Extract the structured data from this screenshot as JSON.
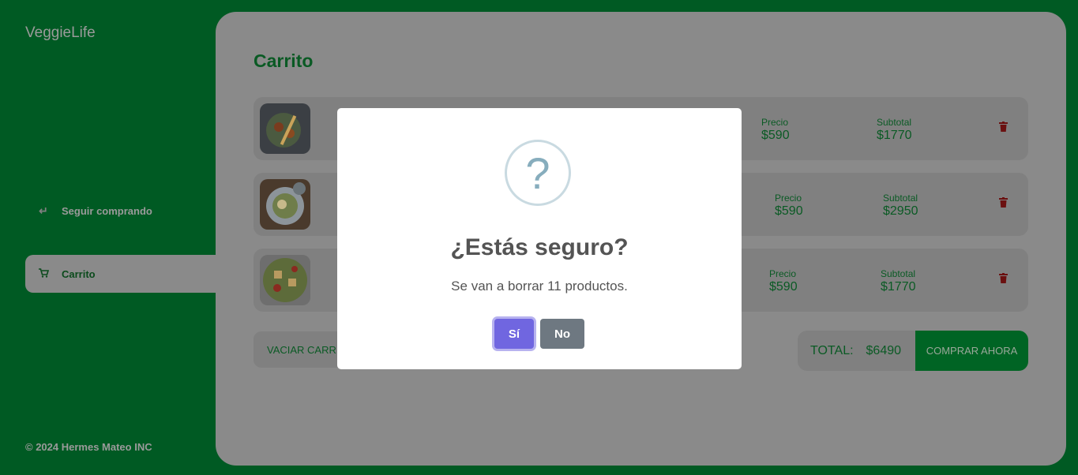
{
  "app": {
    "brand": "VeggieLife",
    "footer": "© 2024 Hermes Mateo INC"
  },
  "sidebar": {
    "items": [
      {
        "label": "Seguir comprando",
        "icon": "return-arrow-icon"
      },
      {
        "label": "Carrito",
        "icon": "cart-icon",
        "active": true
      }
    ]
  },
  "main": {
    "title": "Carrito",
    "rows": [
      {
        "price_label": "Precio",
        "price": "$590",
        "subtotal_label": "Subtotal",
        "subtotal": "$1770"
      },
      {
        "price_label": "Precio",
        "price": "$590",
        "subtotal_label": "Subtotal",
        "subtotal": "$2950"
      },
      {
        "price_label": "Precio",
        "price": "$590",
        "subtotal_label": "Subtotal",
        "subtotal": "$1770"
      }
    ],
    "clear_label": "VACIAR CARRI",
    "total_label": "TOTAL:",
    "total_value": "$6490",
    "buy_label": "COMPRAR AHORA"
  },
  "modal": {
    "icon": "?",
    "title": "¿Estás seguro?",
    "text": "Se van a borrar 11 productos.",
    "confirm_label": "Sí",
    "cancel_label": "No"
  },
  "colors": {
    "background": "#005a23",
    "accent_green": "#0a5a24",
    "confirm": "#7066e0",
    "cancel": "#6e7881"
  }
}
